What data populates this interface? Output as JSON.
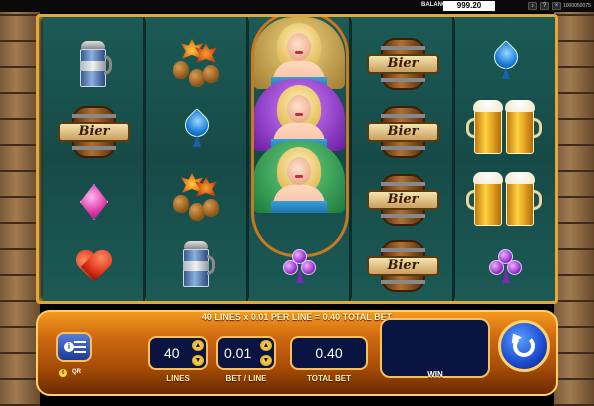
{
  "topbar": {
    "balance_label": "BALANCE",
    "balance_value": "999.20",
    "game_id": "1000050075",
    "controls": [
      "sound-icon",
      "help-icon",
      "close-icon"
    ]
  },
  "reels": [
    [
      "stein",
      "barrel",
      "diamond",
      "heart"
    ],
    [
      "leaves-acorns",
      "spade",
      "leaves-acorns",
      "stein"
    ],
    [
      "girl",
      "girl",
      "girl",
      "club"
    ],
    [
      "barrel",
      "barrel",
      "barrel",
      "barrel"
    ],
    [
      "spade",
      "beer",
      "beer",
      "club"
    ]
  ],
  "barrel_text": "Bier",
  "panel": {
    "bet_summary": "40 LINES x 0.01 PER LINE = 0.40 TOTAL BET",
    "lines_value": "40",
    "bet_per_line_value": "0.01",
    "total_bet_value": "0.40",
    "lines_label": "LINES",
    "bet_per_line_label": "BET / LINE",
    "total_bet_label": "TOTAL BET",
    "win_label": "WIN",
    "qr_label": "QR"
  },
  "colors": {
    "panel_orange": "#d06a10",
    "field_navy": "#0a1440",
    "reel_teal": "#1c5a55",
    "spin_blue": "#1a4ad0"
  }
}
